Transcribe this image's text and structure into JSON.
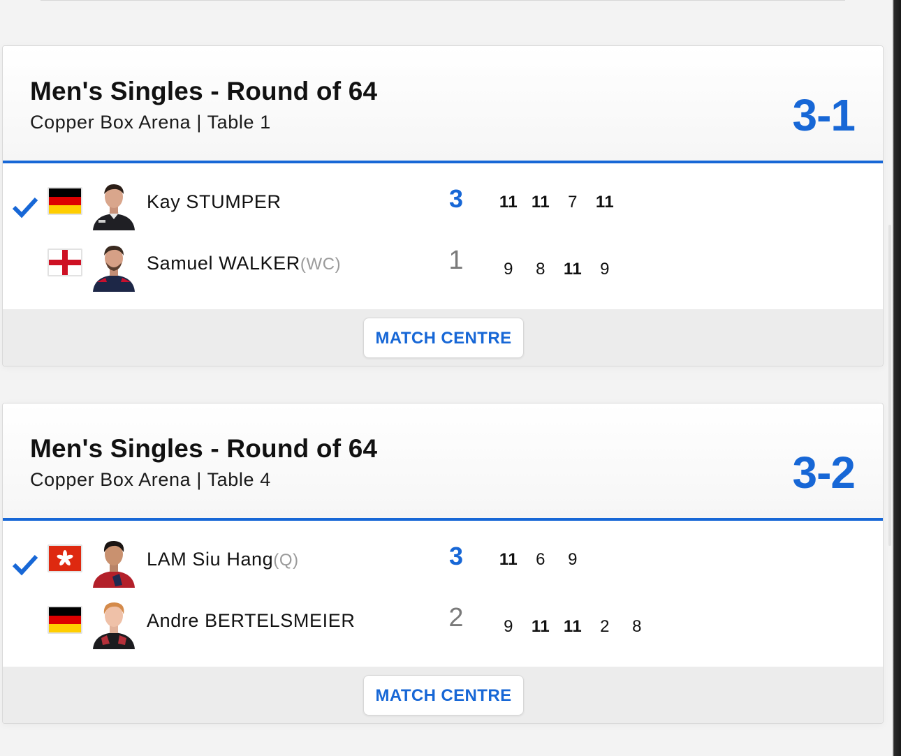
{
  "matches": [
    {
      "title": "Men's Singles - Round of 64",
      "venue": "Copper Box Arena | Table 1",
      "result": "3-1",
      "players": [
        {
          "name": "Kay STUMPER",
          "tag": "",
          "country": "Germany",
          "flag_icon": "germany-flag",
          "winner": true,
          "sets": "3",
          "games": [
            {
              "score": "11",
              "won": true
            },
            {
              "score": "11",
              "won": true
            },
            {
              "score": "7",
              "won": false
            },
            {
              "score": "11",
              "won": true
            }
          ]
        },
        {
          "name": "Samuel WALKER",
          "tag": "(WC)",
          "country": "England",
          "flag_icon": "england-flag",
          "winner": false,
          "sets": "1",
          "games": [
            {
              "score": "9",
              "won": false
            },
            {
              "score": "8",
              "won": false
            },
            {
              "score": "11",
              "won": true
            },
            {
              "score": "9",
              "won": false
            }
          ]
        }
      ],
      "button_label": "MATCH CENTRE"
    },
    {
      "title": "Men's Singles - Round of 64",
      "venue": "Copper Box Arena | Table 4",
      "result": "3-2",
      "players": [
        {
          "name": "LAM Siu Hang",
          "tag": "(Q)",
          "country": "Hong Kong",
          "flag_icon": "hong-kong-flag",
          "winner": true,
          "sets": "3",
          "games": [
            {
              "score": "11",
              "won": true
            },
            {
              "score": "6",
              "won": false
            },
            {
              "score": "9",
              "won": false
            },
            {
              "score": "",
              "won": false
            },
            {
              "score": "",
              "won": false
            }
          ]
        },
        {
          "name": "Andre BERTELSMEIER",
          "tag": "",
          "country": "Germany",
          "flag_icon": "germany-flag",
          "winner": false,
          "sets": "2",
          "games": [
            {
              "score": "9",
              "won": false
            },
            {
              "score": "11",
              "won": true
            },
            {
              "score": "11",
              "won": true
            },
            {
              "score": "2",
              "won": false
            },
            {
              "score": "8",
              "won": false
            }
          ]
        }
      ],
      "button_label": "MATCH CENTRE"
    }
  ],
  "colors": {
    "accent": "#1767d6",
    "muted": "#9a9a9a",
    "footer": "#ececec"
  }
}
